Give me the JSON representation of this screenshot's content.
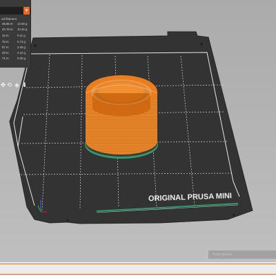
{
  "legend": {
    "header": "ed filament",
    "rows": [
      {
        "m": "46.55 m",
        "g": "10.59 g"
      },
      {
        "m": "44.76 m",
        "g": "10.46 g"
      },
      {
        "m": "44 m",
        "g": "0.11 g"
      },
      {
        "m": "76 m",
        "g": "6.73 g"
      },
      {
        "m": "57 m",
        "g": "2.59 g"
      },
      {
        "m": "33 m",
        "g": "0.15 g"
      },
      {
        "m": "71 m",
        "g": "0.00 g"
      }
    ]
  },
  "bed": {
    "brand_label": "ORIGINAL PRUSA MINI"
  },
  "bottom_button": {
    "label": "Detail Options"
  },
  "icons": [
    "move-icon",
    "rotate-icon",
    "cube-icon",
    "export-icon"
  ],
  "colors": {
    "accent": "#ed6b21",
    "bed": "#333333",
    "print": "#f07d1e",
    "skirt": "#2e9a6e"
  }
}
